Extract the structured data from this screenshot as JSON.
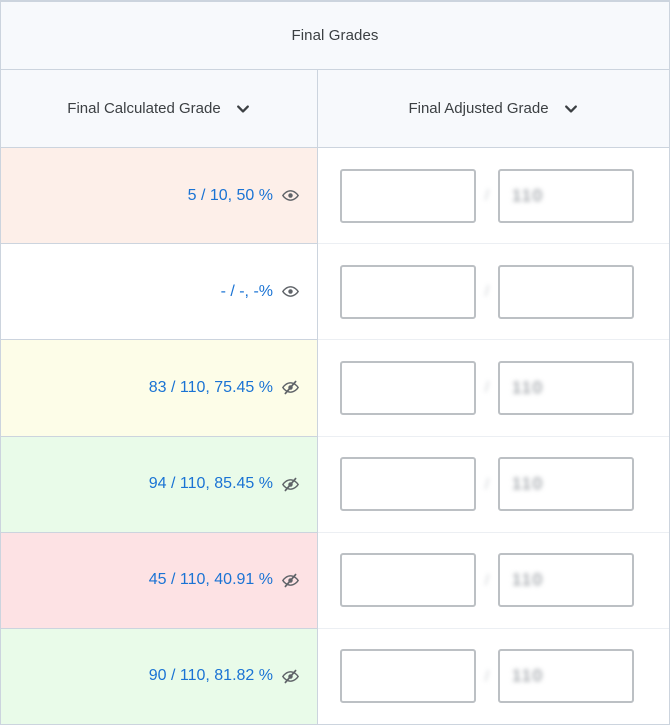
{
  "table": {
    "group_header": "Final Grades",
    "columns": [
      {
        "label": "Final Calculated Grade",
        "sort_icon": "chevron-down-icon"
      },
      {
        "label": "Final Adjusted Grade",
        "sort_icon": "chevron-down-icon"
      }
    ],
    "rows": [
      {
        "calculated": "5 / 10, 50 %",
        "visibility_icon": "eye-icon",
        "visibility_state": "visible",
        "row_color": "#fdefe9",
        "adjusted_numerator": "",
        "adjusted_numerator_placeholder": "",
        "separator": "/",
        "adjusted_denominator": "110"
      },
      {
        "calculated": "- / -, -%",
        "visibility_icon": "eye-icon",
        "visibility_state": "visible",
        "row_color": "#ffffff",
        "adjusted_numerator": "",
        "adjusted_numerator_placeholder": "",
        "separator": "/",
        "adjusted_denominator": ""
      },
      {
        "calculated": "83 / 110, 75.45 %",
        "visibility_icon": "eye-off-icon",
        "visibility_state": "hidden",
        "row_color": "#fdfde8",
        "adjusted_numerator": "",
        "adjusted_numerator_placeholder": "",
        "separator": "/",
        "adjusted_denominator": "110"
      },
      {
        "calculated": "94 / 110, 85.45 %",
        "visibility_icon": "eye-off-icon",
        "visibility_state": "hidden",
        "row_color": "#e9fbe9",
        "adjusted_numerator": "",
        "adjusted_numerator_placeholder": "",
        "separator": "/",
        "adjusted_denominator": "110"
      },
      {
        "calculated": "45 / 110, 40.91 %",
        "visibility_icon": "eye-off-icon",
        "visibility_state": "hidden",
        "row_color": "#fde2e4",
        "adjusted_numerator": "",
        "adjusted_numerator_placeholder": "",
        "separator": "/",
        "adjusted_denominator": "110"
      },
      {
        "calculated": "90 / 110, 81.82 %",
        "visibility_icon": "eye-off-icon",
        "visibility_state": "hidden",
        "row_color": "#e9fbe9",
        "adjusted_numerator": "",
        "adjusted_numerator_placeholder": "",
        "separator": "/",
        "adjusted_denominator": "110"
      }
    ]
  },
  "colors": {
    "grade_text": "#1a73d4",
    "header_bg": "#f7f9fc",
    "border": "#ccd4de",
    "icon": "#5f6368"
  }
}
